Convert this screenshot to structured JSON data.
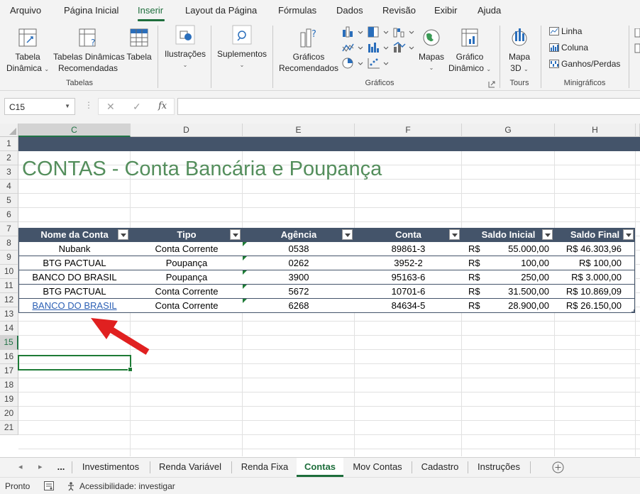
{
  "menu": {
    "tabs": [
      "Arquivo",
      "Página Inicial",
      "Inserir",
      "Layout da Página",
      "Fórmulas",
      "Dados",
      "Revisão",
      "Exibir",
      "Ajuda"
    ],
    "active": "Inserir"
  },
  "ribbon": {
    "tabela_dinamica": [
      "Tabela",
      "Dinâmica"
    ],
    "tabelas_dinamicas_recomendadas": [
      "Tabelas Dinâmicas",
      "Recomendadas"
    ],
    "tabela": "Tabela",
    "ilustracoes": "Ilustrações",
    "suplementos": "Suplementos",
    "graficos_recomendados": [
      "Gráficos",
      "Recomendados"
    ],
    "mapas": "Mapas",
    "grafico_dinamico": [
      "Gráfico",
      "Dinâmico"
    ],
    "mapa_3d": [
      "Mapa",
      "3D"
    ],
    "sparklines": [
      "Linha",
      "Coluna",
      "Ganhos/Perdas"
    ],
    "groups": {
      "tabelas": "Tabelas",
      "graficos": "Gráficos",
      "tours": "Tours",
      "minigraficos": "Minigráficos"
    }
  },
  "formula_bar": {
    "name_box": "C15",
    "fx": "fx",
    "cancel": "✕",
    "enter": "✓",
    "value": ""
  },
  "columns": [
    "C",
    "D",
    "E",
    "F",
    "G",
    "H"
  ],
  "selected_column": "C",
  "rows": [
    "1",
    "2",
    "3",
    "4",
    "5",
    "6",
    "7",
    "8",
    "9",
    "10",
    "11",
    "12",
    "13",
    "14",
    "15",
    "16",
    "17",
    "18",
    "19",
    "20",
    "21"
  ],
  "selected_row": "15",
  "sheet_title": "CONTAS - Conta Bancária e Poupança",
  "table": {
    "headers": [
      "Nome da Conta",
      "Tipo",
      "Agência",
      "Conta",
      "Saldo Inicial",
      "Saldo Final"
    ],
    "rows": [
      {
        "nome": "Nubank",
        "tipo": "Conta Corrente",
        "agencia": "0538",
        "conta": "89861-3",
        "moeda": "R$",
        "saldo_inicial": "55.000,00",
        "saldo_final": "R$ 46.303,96"
      },
      {
        "nome": "BTG PACTUAL",
        "tipo": "Poupança",
        "agencia": "0262",
        "conta": "3952-2",
        "moeda": "R$",
        "saldo_inicial": "100,00",
        "saldo_final": "R$ 100,00"
      },
      {
        "nome": "BANCO DO BRASIL",
        "tipo": "Poupança",
        "agencia": "3900",
        "conta": "95163-6",
        "moeda": "R$",
        "saldo_inicial": "250,00",
        "saldo_final": "R$ 3.000,00"
      },
      {
        "nome": "BTG PACTUAL",
        "tipo": "Conta Corrente",
        "agencia": "5672",
        "conta": "10701-6",
        "moeda": "R$",
        "saldo_inicial": "31.500,00",
        "saldo_final": "R$ 10.869,09"
      },
      {
        "nome": "BANCO DO BRASIL",
        "tipo": "Conta Corrente",
        "agencia": "6268",
        "conta": "84634-5",
        "moeda": "R$",
        "saldo_inicial": "28.900,00",
        "saldo_final": "R$ 26.150,00"
      }
    ]
  },
  "sheet_tabs": [
    "...",
    "Investimentos",
    "Renda Variável",
    "Renda Fixa",
    "Contas",
    "Mov Contas",
    "Cadastro",
    "Instruções"
  ],
  "active_sheet": "Contas",
  "status": {
    "ready": "Pronto",
    "accessibility": "Acessibilidade: investigar"
  },
  "colors": {
    "accent_green": "#1e6e3c",
    "header_navy": "#44546a",
    "title_green": "#548e5c",
    "link_blue": "#2b5fb4",
    "arrow_red": "#e02020"
  }
}
